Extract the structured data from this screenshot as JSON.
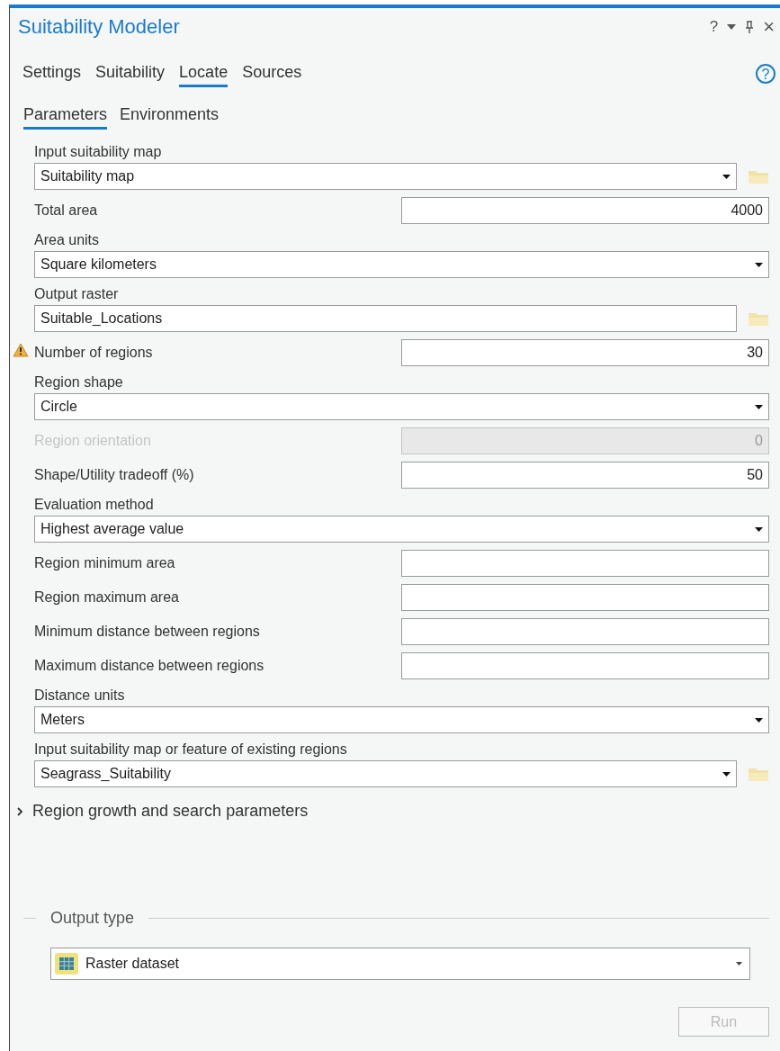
{
  "window": {
    "title": "Suitability Modeler",
    "help_glyph": "?",
    "close_glyph": "×"
  },
  "tabs": [
    {
      "label": "Settings",
      "selected": false
    },
    {
      "label": "Suitability",
      "selected": false
    },
    {
      "label": "Locate",
      "selected": true
    },
    {
      "label": "Sources",
      "selected": false
    }
  ],
  "help_button": "?",
  "subtabs": [
    {
      "label": "Parameters",
      "selected": true
    },
    {
      "label": "Environments",
      "selected": false
    }
  ],
  "parameters": [
    {
      "kind": "dropdown",
      "label": "Input suitability map",
      "value": "Suitability map",
      "browse": true
    },
    {
      "kind": "inline",
      "label": "Total area",
      "value": "4000"
    },
    {
      "kind": "dropdown",
      "label": "Area units",
      "value": "Square kilometers"
    },
    {
      "kind": "text",
      "label": "Output raster",
      "value": "Suitable_Locations",
      "browse": true
    },
    {
      "kind": "inline",
      "label": "Number of regions",
      "value": "30",
      "warning": true
    },
    {
      "kind": "dropdown",
      "label": "Region shape",
      "value": "Circle"
    },
    {
      "kind": "inline",
      "label": "Region orientation",
      "value": "0",
      "disabled": true
    },
    {
      "kind": "inline",
      "label": "Shape/Utility tradeoff (%)",
      "value": "50"
    },
    {
      "kind": "dropdown",
      "label": "Evaluation method",
      "value": "Highest average value"
    },
    {
      "kind": "inline",
      "label": "Region minimum area"
    },
    {
      "kind": "inline",
      "label": "Region maximum area"
    },
    {
      "kind": "inline",
      "label": "Minimum distance between regions"
    },
    {
      "kind": "inline",
      "label": "Maximum distance between regions"
    },
    {
      "kind": "dropdown",
      "label": "Distance units",
      "value": "Meters"
    },
    {
      "kind": "dropdown",
      "label": "Input suitability map or feature of existing regions",
      "value": "Seagrass_Suitability",
      "browse": true
    }
  ],
  "section": {
    "label": "Region growth and search parameters",
    "expanded": false
  },
  "output_type": {
    "legend": "Output type",
    "value": "Raster dataset"
  },
  "run_button": {
    "label": "Run",
    "disabled": true
  }
}
